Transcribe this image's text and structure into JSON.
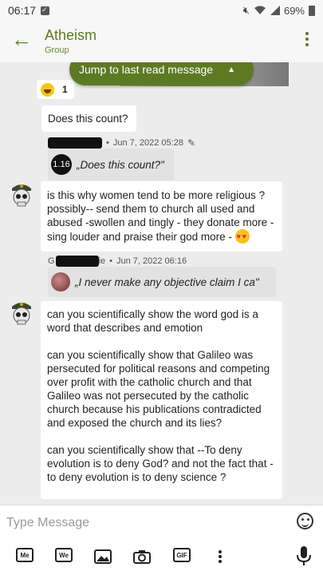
{
  "status_bar": {
    "time": "06:17",
    "battery": "69%"
  },
  "header": {
    "title": "Atheism",
    "subtitle": "Group"
  },
  "jump_button": {
    "label": "Jump to last read message"
  },
  "reaction": {
    "count": "1"
  },
  "messages": [
    {
      "text": "Does this count?"
    },
    {
      "meta_date": "Jun 7, 2022 05:28",
      "quote_badge": "1.16",
      "quote_text": "„Does this count?\"",
      "text": "is this why women tend to be more religious ? possibly-- send them to church all used and abused -swollen and tingly - they donate more - sing louder and praise their god more -"
    },
    {
      "meta_prefix": "G",
      "meta_suffix": "ie",
      "meta_date": "Jun 7, 2022 06:16",
      "quote_text": "„I never make any objective claim I ca\"",
      "paragraphs": [
        "can you scientifically show the word god is a word that describes and emotion",
        "can you scientifically show that Galileo was persecuted for political reasons and competing over profit with the catholic church and that Galileo was not persecuted by the catholic church because his publications contradicted and exposed the church and its lies?",
        "can you scientifically show that --To deny evolution is to deny God? and not the fact that -to deny evolution is to deny science ?"
      ]
    }
  ],
  "composer": {
    "placeholder": "Type Message",
    "tools": {
      "me": "Me",
      "we": "We",
      "gif": "GIF"
    }
  },
  "icons": [
    "back-arrow-icon",
    "more-vert-icon",
    "laughing-emoji-icon",
    "pencil-icon",
    "heart-eyes-emoji-icon",
    "smiley-icon",
    "image-icon",
    "camera-icon",
    "microphone-icon"
  ],
  "colors": {
    "accent": "#5c7a1f",
    "jump_bg": "#5d7a22",
    "chat_bg": "#ececec"
  }
}
